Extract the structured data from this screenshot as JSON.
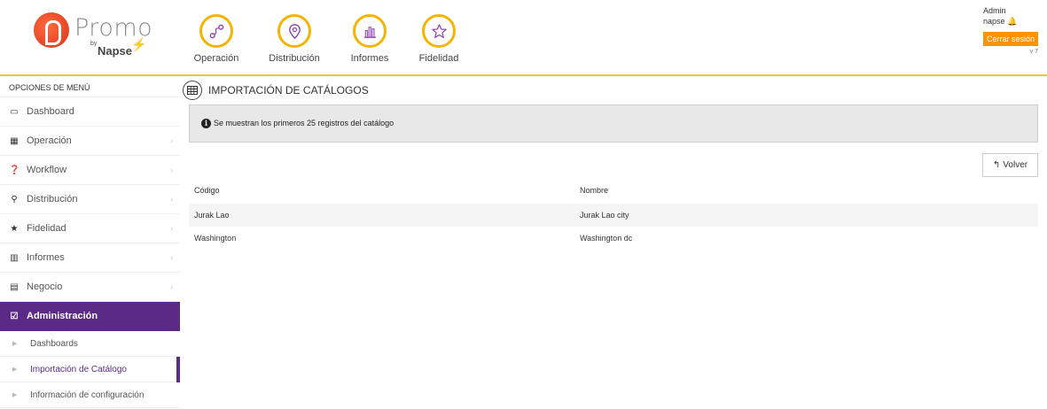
{
  "app": {
    "logo_text": "Promo",
    "logo_by": "by",
    "logo_brand": "Napse"
  },
  "topnav": {
    "items": [
      {
        "label": "Operación",
        "icon": "route-icon"
      },
      {
        "label": "Distribución",
        "icon": "map-pin-icon"
      },
      {
        "label": "Informes",
        "icon": "bar-chart-icon"
      },
      {
        "label": "Fidelidad",
        "icon": "star-icon"
      }
    ]
  },
  "user": {
    "role": "Admin",
    "name": "napse",
    "logout_label": "Cerrar sesión",
    "version": "v 7"
  },
  "sidebar": {
    "title": "OPCIONES DE MENÚ",
    "items": [
      {
        "label": "Dashboard",
        "icon": "laptop-icon",
        "glyph": "▭"
      },
      {
        "label": "Operación",
        "icon": "grid-icon",
        "glyph": "▦"
      },
      {
        "label": "Workflow",
        "icon": "question-circle-icon",
        "glyph": "❓"
      },
      {
        "label": "Distribución",
        "icon": "map-marker-icon",
        "glyph": "⚲"
      },
      {
        "label": "Fidelidad",
        "icon": "star-icon",
        "glyph": "★"
      },
      {
        "label": "Informes",
        "icon": "bar-chart-icon",
        "glyph": "▥"
      },
      {
        "label": "Negocio",
        "icon": "building-icon",
        "glyph": "▤"
      },
      {
        "label": "Administración",
        "icon": "calendar-check-icon",
        "glyph": "☑"
      }
    ],
    "subitems": [
      {
        "label": "Dashboards"
      },
      {
        "label": "Importación de Catálogo"
      },
      {
        "label": "Información de configuración"
      }
    ]
  },
  "main": {
    "title": "IMPORTACIÓN DE CATÁLOGOS",
    "alert": "Se muestran los primeros 25 registros del catálogo",
    "back_label": "Volver",
    "table": {
      "headers": [
        "Código",
        "Nombre"
      ],
      "rows": [
        [
          "Jurak Lao",
          "Jurak Lao city"
        ],
        [
          "Washington",
          "Washington dc"
        ]
      ]
    }
  },
  "colors": {
    "accent_purple": "#5b2a86",
    "nav_ring": "#f4b400",
    "logout": "#f89406",
    "header_rule": "#f4c430"
  }
}
